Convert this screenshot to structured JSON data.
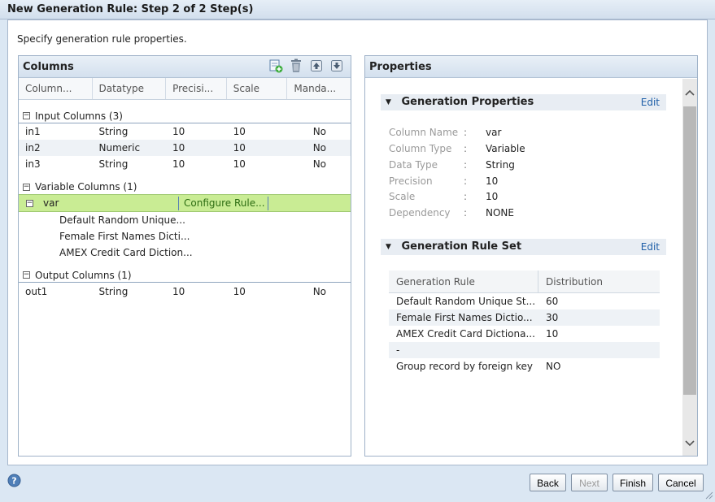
{
  "window": {
    "title": "New Generation Rule: Step 2 of 2 Step(s)"
  },
  "instruction": "Specify generation rule properties.",
  "columns_panel": {
    "title": "Columns",
    "toolbar": [
      "add-icon",
      "delete-icon",
      "move-up-icon",
      "move-down-icon"
    ],
    "headers": [
      "Column...",
      "Datatype",
      "Precisi...",
      "Scale",
      "Manda..."
    ],
    "input_group": {
      "label": "Input Columns (3)",
      "rows": [
        {
          "name": "in1",
          "datatype": "String",
          "precision": "10",
          "scale": "10",
          "mandatory": "No"
        },
        {
          "name": "in2",
          "datatype": "Numeric",
          "precision": "10",
          "scale": "10",
          "mandatory": "No"
        },
        {
          "name": "in3",
          "datatype": "String",
          "precision": "10",
          "scale": "10",
          "mandatory": "No"
        }
      ]
    },
    "variable_group": {
      "label": "Variable Columns (1)",
      "var_name": "var",
      "configure_label": "Configure Rule...",
      "rules": [
        "Default Random Unique...",
        "Female First Names Dicti...",
        "AMEX Credit Card Diction..."
      ]
    },
    "output_group": {
      "label": "Output Columns (1)",
      "rows": [
        {
          "name": "out1",
          "datatype": "String",
          "precision": "10",
          "scale": "10",
          "mandatory": "No"
        }
      ]
    }
  },
  "properties_panel": {
    "title": "Properties",
    "generation_properties": {
      "title": "Generation Properties",
      "edit_label": "Edit",
      "items": [
        {
          "key": "Column Name",
          "value": "var"
        },
        {
          "key": "Column Type",
          "value": "Variable"
        },
        {
          "key": "Data Type",
          "value": "String"
        },
        {
          "key": "Precision",
          "value": "10"
        },
        {
          "key": "Scale",
          "value": "10"
        },
        {
          "key": "Dependency",
          "value": "NONE"
        }
      ]
    },
    "rule_set": {
      "title": "Generation Rule Set",
      "edit_label": "Edit",
      "headers": [
        "Generation Rule",
        "Distribution"
      ],
      "rows": [
        {
          "rule": "Default Random Unique St...",
          "distribution": "60"
        },
        {
          "rule": "Female First Names Dictio...",
          "distribution": "30"
        },
        {
          "rule": "AMEX Credit Card Dictiona...",
          "distribution": "10"
        },
        {
          "rule": "-",
          "distribution": ""
        },
        {
          "rule": "Group record by foreign key",
          "distribution": "NO"
        }
      ]
    }
  },
  "footer": {
    "back": "Back",
    "next": "Next",
    "finish": "Finish",
    "cancel": "Cancel"
  },
  "colors": {
    "accent": "#1f5fa8",
    "selection": "#c9ec94",
    "disabled_text": "#9a9a9a"
  }
}
